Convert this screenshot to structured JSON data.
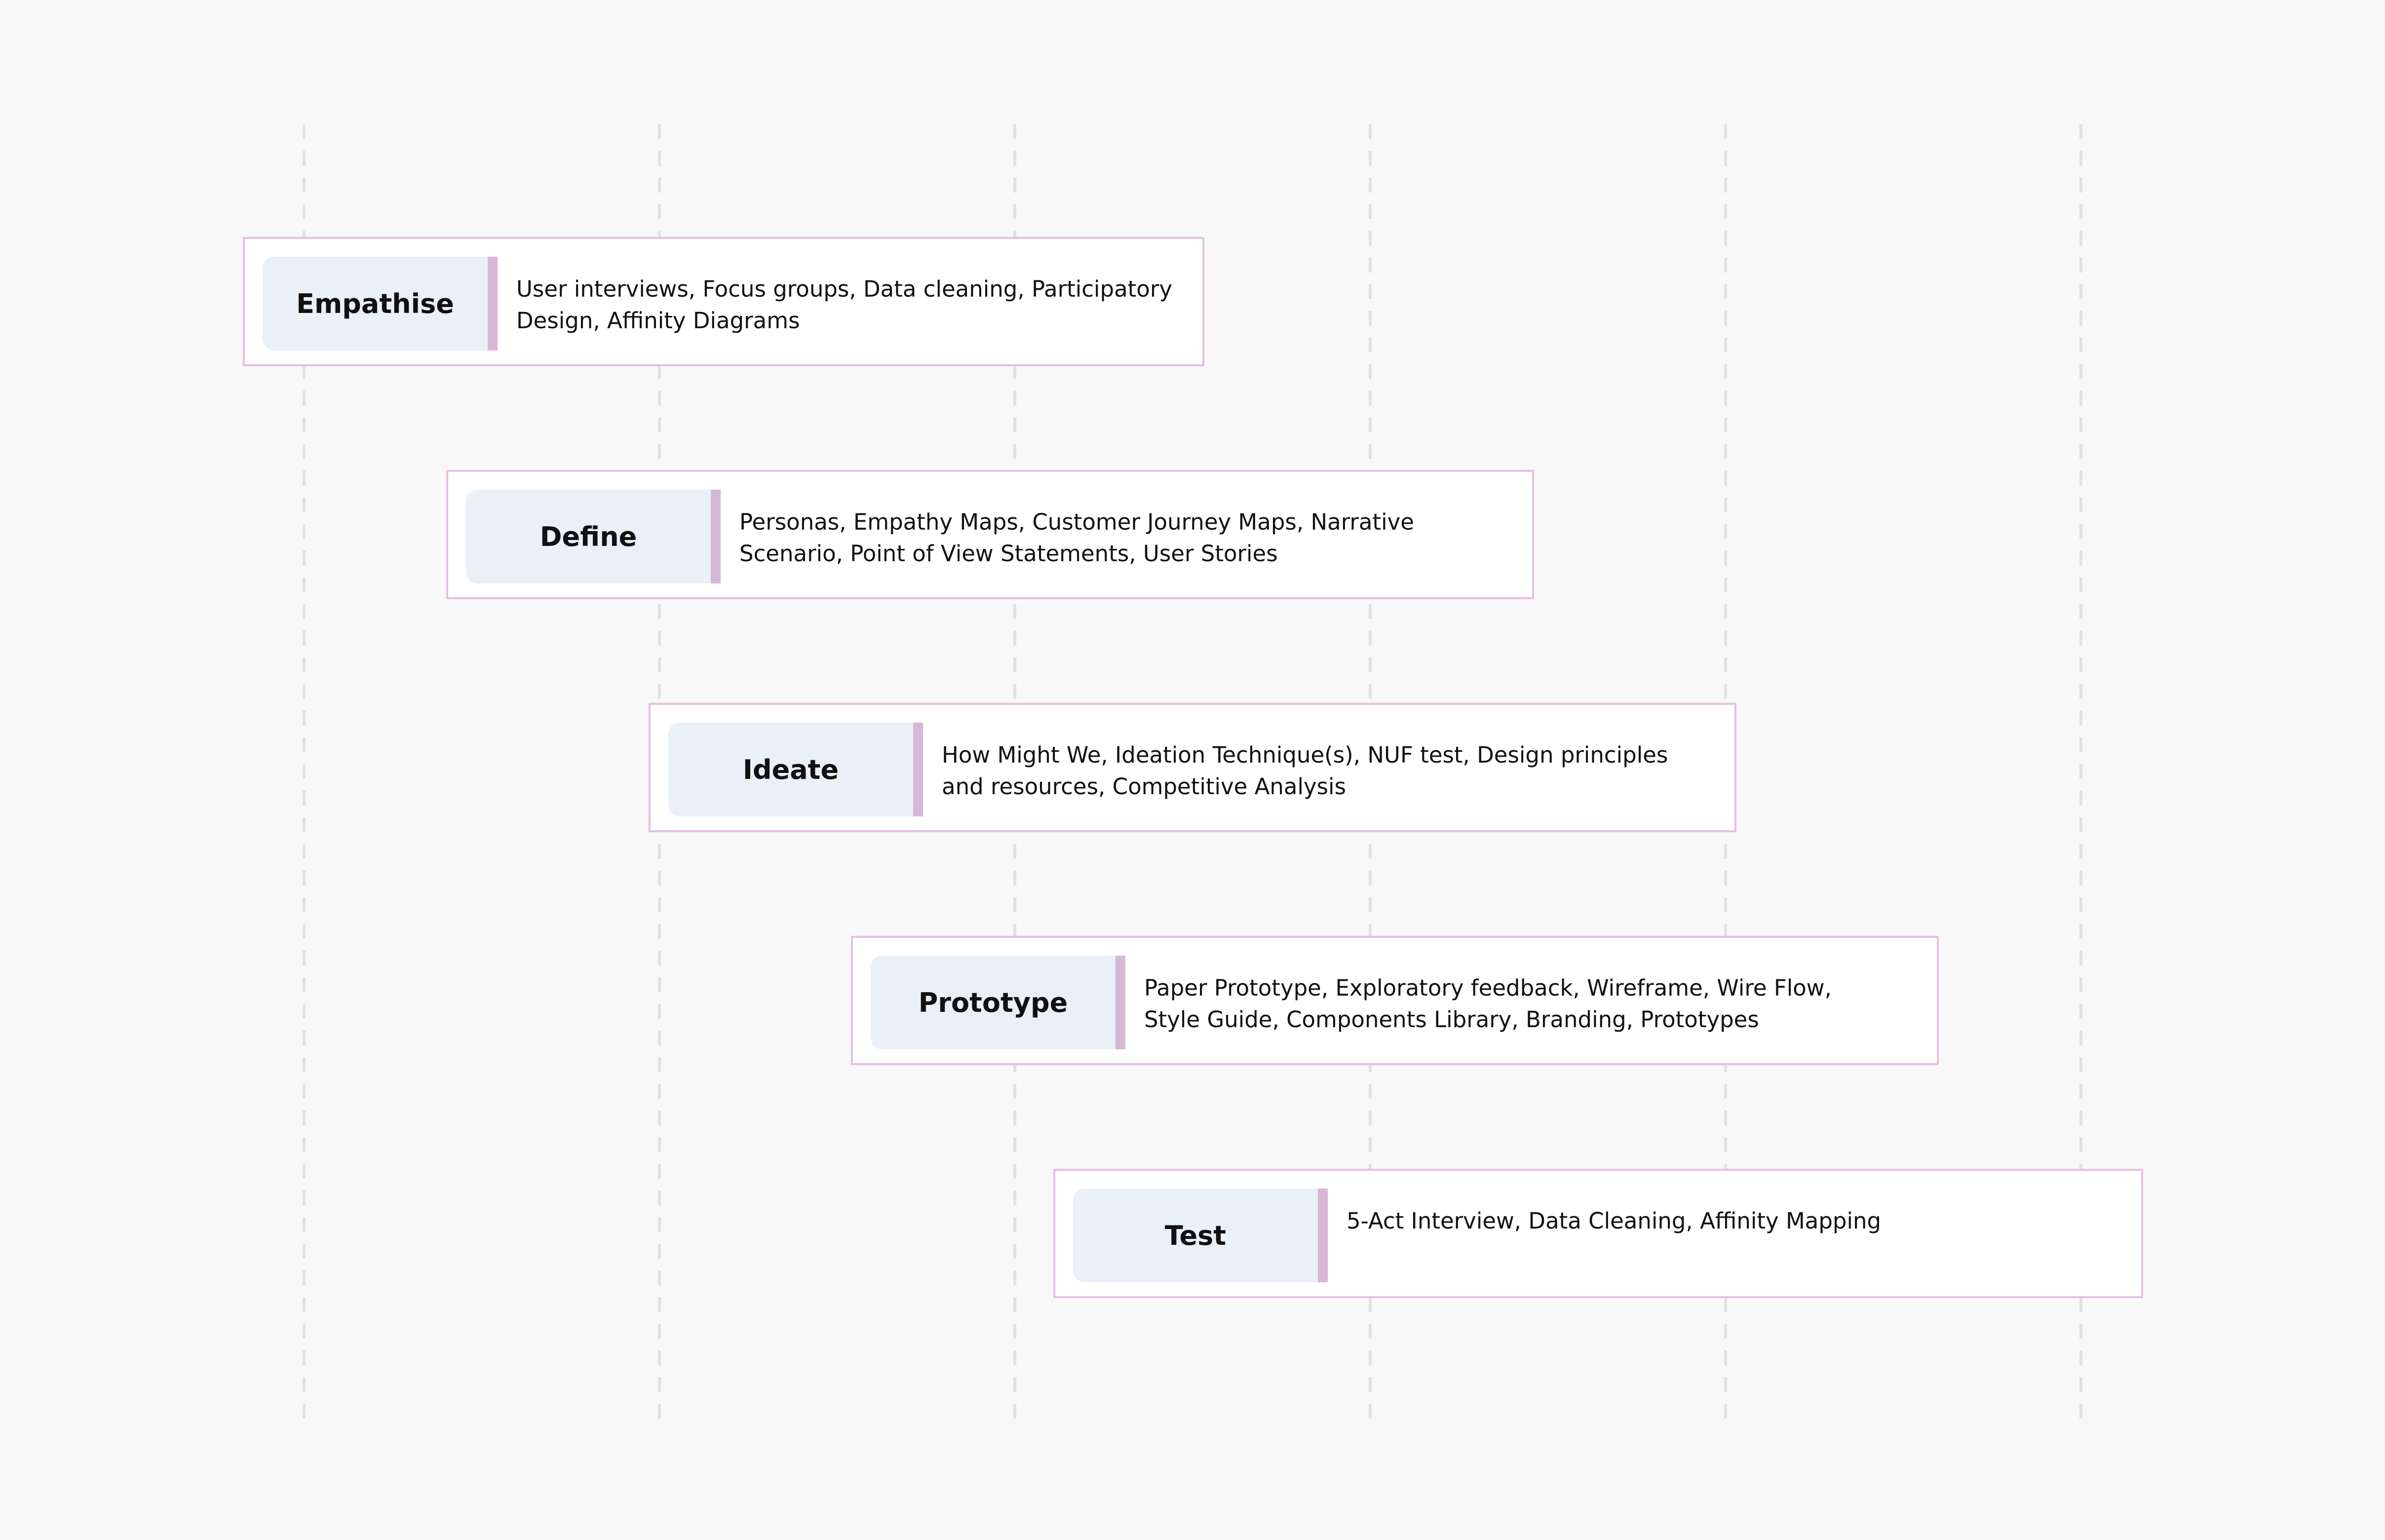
{
  "colors": {
    "background": "#f8f8f8",
    "card_border": "#e6bfde",
    "label_fill": "#e9f0f7",
    "accent_bar": "#d7b7d6",
    "guide_line": "#e1e1e1"
  },
  "stages": [
    {
      "name": "Empathise",
      "methods": "User interviews, Focus groups,  Data cleaning, Participatory\nDesign, Affinity Diagrams"
    },
    {
      "name": "Define",
      "methods": "Personas, Empathy Maps, Customer Journey Maps, Narrative\nScenario, Point of View Statements, User Stories"
    },
    {
      "name": "Ideate",
      "methods": "How Might We, Ideation Technique(s), NUF test, Design principles\nand resources, Competitive Analysis"
    },
    {
      "name": "Prototype",
      "methods": "Paper Prototype, Exploratory feedback, Wireframe, Wire Flow,\nStyle Guide, Components Library, Branding, Prototypes"
    },
    {
      "name": "Test",
      "methods": "5-Act Interview, Data Cleaning, Affinity Mapping"
    }
  ]
}
